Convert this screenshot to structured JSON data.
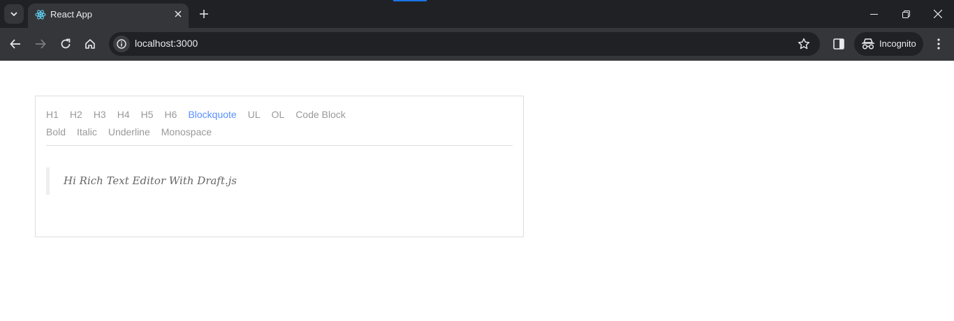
{
  "browser": {
    "tab": {
      "title": "React App"
    },
    "address_bar": {
      "url": "localhost:3000"
    },
    "profile": {
      "label": "Incognito"
    },
    "icons": [
      "tab-search-icon",
      "react-favicon-icon",
      "close-icon",
      "plus-icon",
      "minimize-icon",
      "restore-icon",
      "close-window-icon",
      "back-icon",
      "forward-icon",
      "reload-icon",
      "home-icon",
      "site-info-icon",
      "star-icon",
      "side-panel-icon",
      "incognito-icon",
      "more-vert-icon"
    ]
  },
  "editor": {
    "block_styles": [
      {
        "label": "H1",
        "active": false
      },
      {
        "label": "H2",
        "active": false
      },
      {
        "label": "H3",
        "active": false
      },
      {
        "label": "H4",
        "active": false
      },
      {
        "label": "H5",
        "active": false
      },
      {
        "label": "H6",
        "active": false
      },
      {
        "label": "Blockquote",
        "active": true
      },
      {
        "label": "UL",
        "active": false
      },
      {
        "label": "OL",
        "active": false
      },
      {
        "label": "Code Block",
        "active": false
      }
    ],
    "inline_styles": [
      {
        "label": "Bold",
        "active": false
      },
      {
        "label": "Italic",
        "active": false
      },
      {
        "label": "Underline",
        "active": false
      },
      {
        "label": "Monospace",
        "active": false
      }
    ],
    "content": {
      "blockquote_text": "Hi Rich Text Editor With Draft.js"
    }
  },
  "colors": {
    "chrome_dark": "#202124",
    "chrome_toolbar": "#35363a",
    "active_style": "#5890ff",
    "inactive_style": "#999999"
  }
}
